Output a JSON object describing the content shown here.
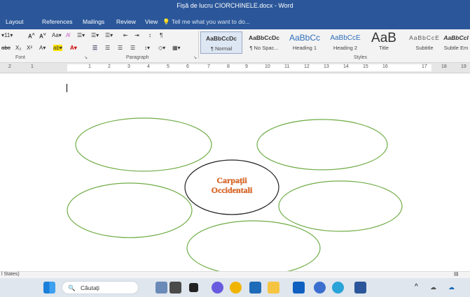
{
  "window": {
    "title": "Fișă de lucru CIORCHINELE.docx - Word"
  },
  "menu": {
    "tabs": [
      "Layout",
      "References",
      "Mailings",
      "Review",
      "View"
    ],
    "tell": "Tell me what you want to do..."
  },
  "ribbon": {
    "font_size": "11",
    "group_font": "Font",
    "group_paragraph": "Paragraph",
    "group_styles": "Styles",
    "styles": [
      {
        "preview": "AaBbCcDc",
        "name": "¶ Normal"
      },
      {
        "preview": "AaBbCcDc",
        "name": "¶ No Spac..."
      },
      {
        "preview": "AaBbCc",
        "name": "Heading 1"
      },
      {
        "preview": "AaBbCcE",
        "name": "Heading 2"
      },
      {
        "preview": "AaB",
        "name": "Title"
      },
      {
        "preview": "AaBbCcE",
        "name": "Subtitle"
      },
      {
        "preview": "AaBbCcI",
        "name": "Subtle Em"
      }
    ]
  },
  "ruler": {
    "numbers": [
      "2",
      "1",
      "1",
      "2",
      "3",
      "4",
      "5",
      "6",
      "7",
      "8",
      "9",
      "10",
      "11",
      "12",
      "13",
      "14",
      "15",
      "16",
      "17",
      "18",
      "19"
    ]
  },
  "document": {
    "center_line1": "Carpații",
    "center_line2": "Occidentali",
    "center_color": "#e8702a",
    "oval_color": "#70ad47"
  },
  "status": {
    "language": "l States)"
  },
  "taskbar": {
    "search": "Căutați"
  }
}
